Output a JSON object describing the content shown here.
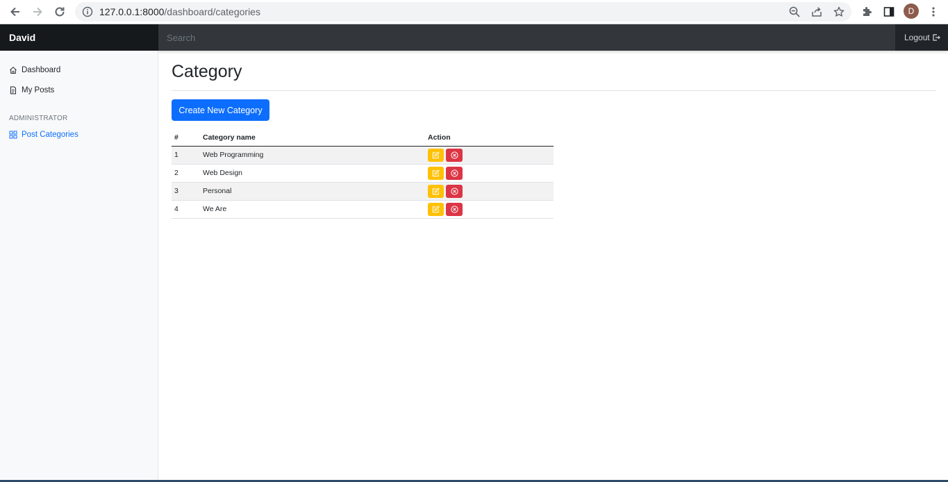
{
  "browser": {
    "url_host": "127.0.0.1:8000",
    "url_path": "/dashboard/categories",
    "profile_initial": "D"
  },
  "navbar": {
    "brand": "David",
    "search_placeholder": "Search",
    "logout_label": "Logout"
  },
  "sidebar": {
    "items": [
      {
        "label": "Dashboard",
        "icon": "house-icon"
      },
      {
        "label": "My Posts",
        "icon": "file-text-icon"
      }
    ],
    "admin_heading": "ADMINISTRATOR",
    "admin_items": [
      {
        "label": "Post Categories",
        "icon": "grid-icon",
        "active": true
      }
    ]
  },
  "main": {
    "title": "Category",
    "create_button": "Create New Category",
    "table": {
      "headers": [
        "#",
        "Category name",
        "Action"
      ],
      "rows": [
        {
          "num": "1",
          "name": "Web Programming"
        },
        {
          "num": "2",
          "name": "Web Design"
        },
        {
          "num": "3",
          "name": "Personal"
        },
        {
          "num": "4",
          "name": "We Are"
        }
      ]
    }
  },
  "colors": {
    "primary": "#0d6efd",
    "warning": "#ffc107",
    "danger": "#dc3545",
    "navbar": "#212529"
  }
}
